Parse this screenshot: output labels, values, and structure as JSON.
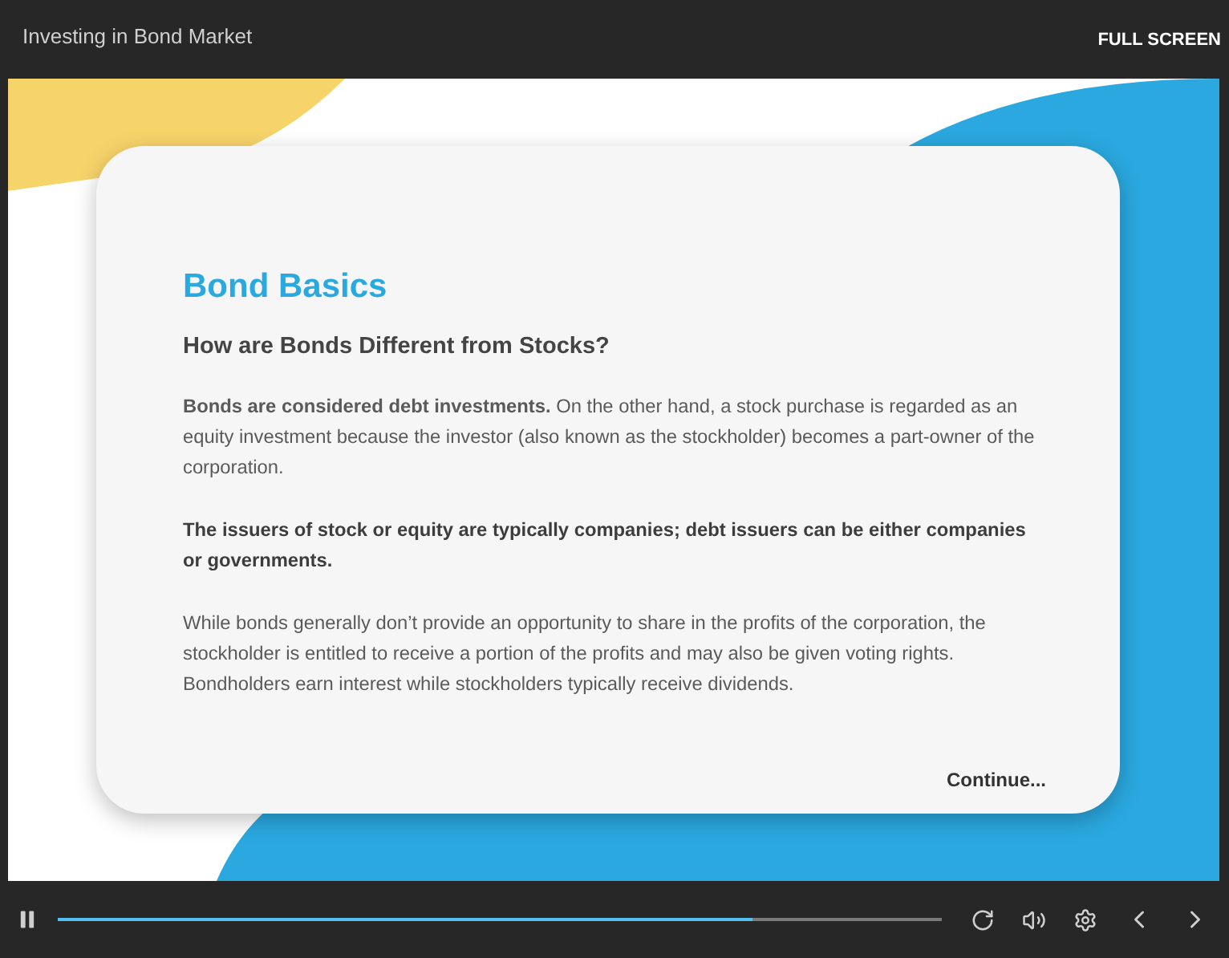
{
  "window": {
    "title": "Investing in Bond Market",
    "fullscreen_label": "FULL SCREEN"
  },
  "slide": {
    "title": "Bond Basics",
    "subtitle": "How are Bonds Different from Stocks?",
    "paragraphs": [
      {
        "kind": "body",
        "text": "**Bonds are considered debt investments.** On the other hand, a stock purchase is regarded as an equity investment because the investor (also known as the stockholder) becomes a part-owner of the corporation."
      },
      {
        "kind": "emphasis",
        "text": "The issuers of stock or equity are typically companies; debt issuers can be either companies or governments."
      },
      {
        "kind": "body",
        "text": "While bonds generally don’t provide an opportunity to share in the profits of the corporation, the stockholder is entitled to receive a portion of the profits and may also be given voting rights. Bondholders earn interest while stockholders typically receive dividends."
      }
    ],
    "continue_label": "Continue..."
  },
  "player": {
    "playing": true,
    "progress": {
      "level": 0.786
    }
  }
}
